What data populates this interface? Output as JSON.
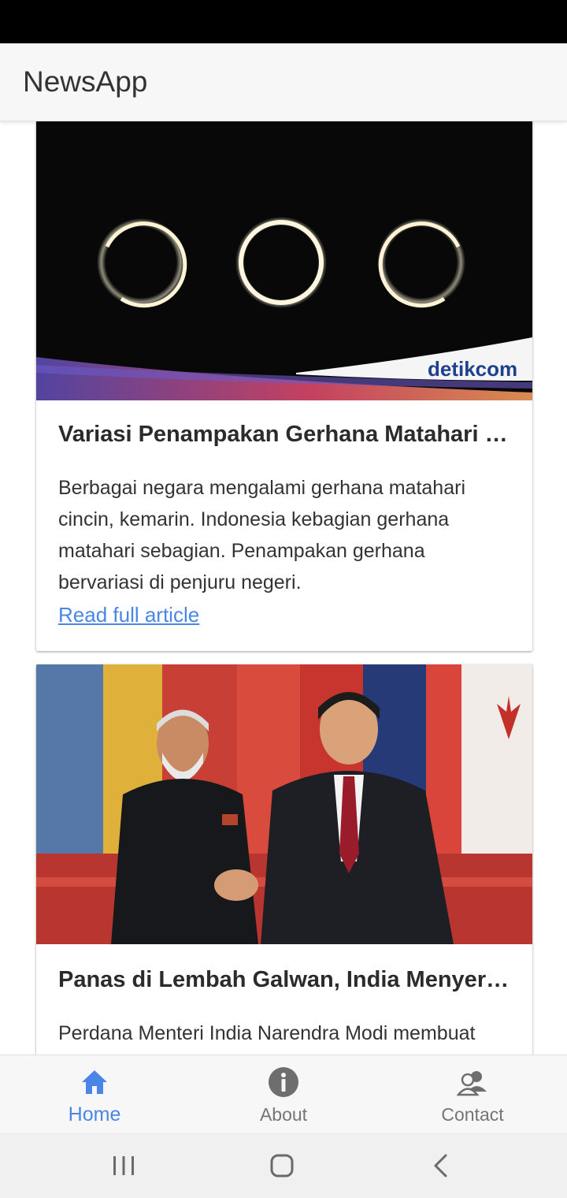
{
  "app": {
    "title": "NewsApp"
  },
  "articles": [
    {
      "image": "solar-eclipse-image",
      "watermark": "detikcom",
      "title": "Variasi Penampakan Gerhana Matahari …",
      "description": "Berbagai negara mengalami gerhana matahari cincin, kemarin. Indonesia kebagian gerhana matahari sebagian. Penampakan gerhana bervariasi di penjuru negeri.",
      "link_label": "Read full article"
    },
    {
      "image": "leaders-handshake-image",
      "title": "Panas di Lembah Galwan, India Menyera…",
      "description": "Perdana Menteri India Narendra Modi membuat"
    }
  ],
  "bottom_nav": {
    "items": [
      {
        "label": "Home",
        "icon": "home-icon",
        "active": true
      },
      {
        "label": "About",
        "icon": "info-icon",
        "active": false
      },
      {
        "label": "Contact",
        "icon": "contacts-icon",
        "active": false
      }
    ]
  },
  "system_nav": {
    "buttons": [
      "recent-apps-icon",
      "home-circle-icon",
      "back-chevron-icon"
    ]
  },
  "colors": {
    "accent": "#4a86e8",
    "header_bg": "#f7f7f7",
    "status_bar": "#000000",
    "text_primary": "#2b2b2b",
    "nav_inactive": "#757575"
  }
}
